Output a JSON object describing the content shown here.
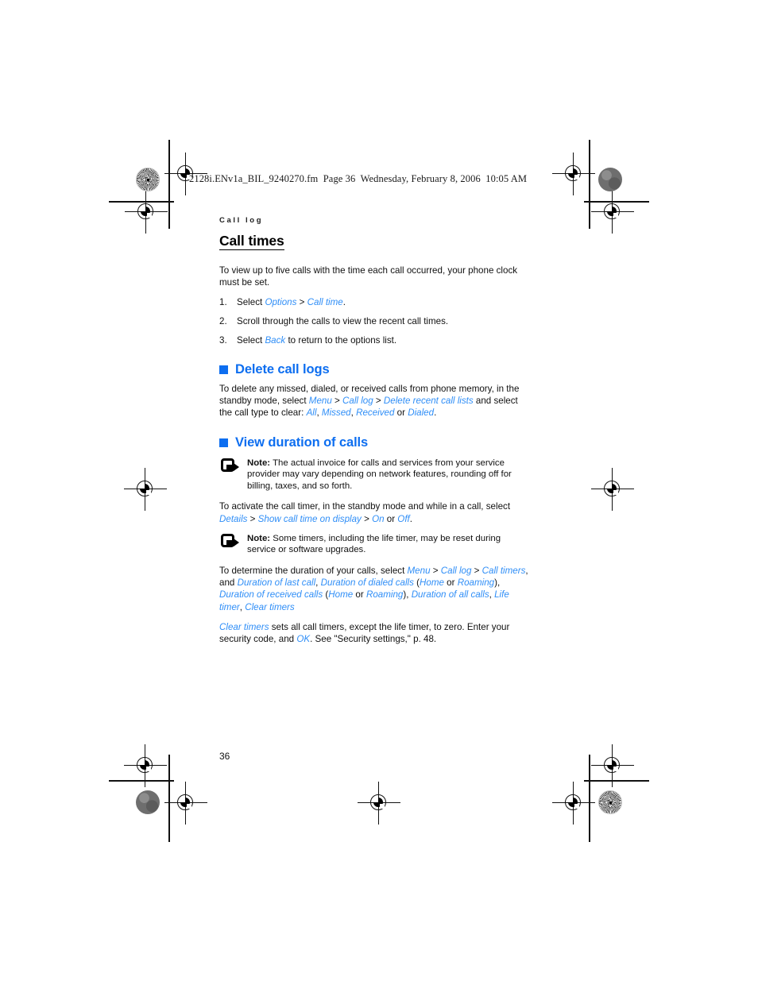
{
  "document": {
    "slug_line": "2128i.ENv1a_BIL_9240270.fm  Page 36  Wednesday, February 8, 2006  10:05 AM",
    "running_head": "Call log",
    "folio": "36",
    "accent_color": "#0d6ef0",
    "ui_term_color": "#2f8ef7"
  },
  "sections": {
    "call_times": {
      "heading": "Call times",
      "intro": "To view up to five calls with the time each call occurred, your phone clock must be set.",
      "steps": [
        {
          "number": "1.",
          "pre": "Select ",
          "term1": "Options",
          "sep": " > ",
          "term2": "Call time",
          "post": "."
        },
        {
          "number": "2.",
          "pre": "Scroll through the calls to view the recent call times.",
          "term1": "",
          "sep": "",
          "term2": "",
          "post": ""
        },
        {
          "number": "3.",
          "pre": "Select ",
          "term1": "Back",
          "sep": "",
          "term2": "",
          "post": " to return to the options list."
        }
      ]
    },
    "delete_call_logs": {
      "heading": "Delete call logs",
      "p1_a": "To delete any missed, dialed, or received calls from phone memory, in the standby mode, select ",
      "p1_menu": "Menu",
      "p1_sep1": " > ",
      "p1_calllog": "Call log",
      "p1_sep2": " > ",
      "p1_delete": "Delete recent call lists",
      "p1_b": " and select the call type to clear: ",
      "p1_all": "All",
      "p1_c": ", ",
      "p1_missed": "Missed",
      "p1_d": ", ",
      "p1_received": "Received",
      "p1_e": " or ",
      "p1_dialed": "Dialed",
      "p1_f": "."
    },
    "view_duration": {
      "heading": "View duration of calls",
      "note1_label": "Note:",
      "note1_text": " The actual invoice for calls and services from your service provider may vary depending on network features, rounding off for billing, taxes, and so forth.",
      "p2_a": "To activate the call timer, in the standby mode and while in a call, select ",
      "p2_details": "Details",
      "p2_sep1": " > ",
      "p2_show": "Show call time on display",
      "p2_sep2": " > ",
      "p2_on": "On",
      "p2_b": " or ",
      "p2_off": "Off",
      "p2_c": ".",
      "note2_label": "Note:",
      "note2_text": " Some timers, including the life timer, may be reset during service or software upgrades.",
      "p3_a": "To determine the duration of your calls, select ",
      "p3_menu": "Menu",
      "p3_sep1": " > ",
      "p3_calllog": "Call log",
      "p3_sep2": " > ",
      "p3_calltimers": "Call timers",
      "p3_b": ", and ",
      "p3_lastcall": "Duration of last call",
      "p3_c": ", ",
      "p3_dialed": "Duration of dialed calls",
      "p3_d": " (",
      "p3_home1": "Home",
      "p3_e": " or ",
      "p3_roaming1": "Roaming",
      "p3_f": "), ",
      "p3_received": "Duration of received calls",
      "p3_g": " (",
      "p3_home2": "Home",
      "p3_h": " or ",
      "p3_roaming2": "Roaming",
      "p3_i": "), ",
      "p3_allcalls": "Duration of all calls",
      "p3_j": ", ",
      "p3_lifetimer": "Life timer",
      "p3_k": ", ",
      "p3_cleartimers": "Clear timers",
      "p4_clear": "Clear timers",
      "p4_a": " sets all call timers, except the life timer, to zero. Enter your security code, and ",
      "p4_ok": "OK",
      "p4_b": ". See \"Security settings,\" p. 48."
    }
  }
}
